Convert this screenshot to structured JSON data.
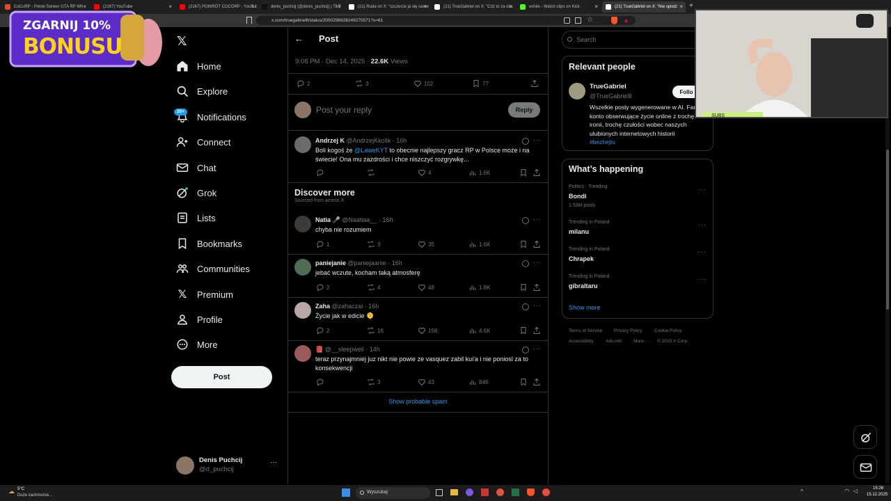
{
  "browser": {
    "tabs": [
      {
        "label": "CoCoRP - Polski Serwer GTA RP Wh",
        "color": "#e14b2a"
      },
      {
        "label": "(2167) YouTube",
        "color": "#ff0000"
      },
      {
        "label": "(2167) POWRÓT COCORP - YouTube",
        "color": "#ff0000"
      },
      {
        "label": "denis_puchcij (@denis_puchcij) | TikT",
        "color": "#111111"
      },
      {
        "label": "(21) Ruda on X: \"szczerze ja się same",
        "color": "#ffffff"
      },
      {
        "label": "(21) TrueGabriel on X: \"Cóż to za obs",
        "color": "#ffffff"
      },
      {
        "label": "eshiie - Watch clips on Kick",
        "color": "#53fc18"
      },
      {
        "label": "(21) TrueGabriel on X: \"Nie spodz",
        "color": "#ffffff"
      }
    ],
    "url": "x.com/truegabrielll/status/2000296928249270571?s=61"
  },
  "promo": {
    "line1": "ZGARNIJ 10%",
    "line2": "BONUSU"
  },
  "nav": {
    "items": [
      "Home",
      "Explore",
      "Notifications",
      "Connect",
      "Chat",
      "Grok",
      "Lists",
      "Bookmarks",
      "Communities",
      "Premium",
      "Profile",
      "More"
    ],
    "notif_badge": "20+",
    "post_button": "Post"
  },
  "account": {
    "name": "Denis Puchcij",
    "handle": "@d_puchcij"
  },
  "header": {
    "title": "Post"
  },
  "main_post": {
    "time": "9:08 PM · Dec 14, 2025 · ",
    "views_value": "22.6K",
    "views_label": " Views",
    "replies": "2",
    "reposts": "3",
    "likes": "102",
    "bookmarks": "77"
  },
  "reply_box": {
    "placeholder": "Post your reply",
    "button": "Reply"
  },
  "replies": [
    {
      "name": "Andrzej K",
      "handle": "@AndrzejKkolik · 16h",
      "text_before": "Boli kogoś że ",
      "mention": "@LaweKYT",
      "text_after": " to obecnie najlepszy gracz RP w Polsce może i na świecie! Ona mu zazdrości i chce niszczyć rozgrywkę...",
      "replies": "",
      "reposts": "",
      "likes": "4",
      "views": "1.6K"
    }
  ],
  "discover": {
    "title": "Discover more",
    "subtitle": "Sourced from across X"
  },
  "discover_posts": [
    {
      "name": "Natia",
      "emoji": "🎤",
      "handle": "@Naatiaa__ · 16h",
      "text": "chyba nie rozumiem",
      "replies": "1",
      "reposts": "3",
      "likes": "35",
      "views": "1.6K"
    },
    {
      "name": "paniejanie",
      "emoji": "",
      "handle": "@paniejaanie · 16h",
      "text": "jebać wczute, kocham taką atmosferę",
      "replies": "2",
      "reposts": "4",
      "likes": "48",
      "views": "1.8K"
    },
    {
      "name": "Zaha",
      "emoji": "",
      "handle": "@zahaczai · 16h",
      "text": "Życie jak w edicie 🫠",
      "replies": "2",
      "reposts": "16",
      "likes": "158",
      "views": "4.6K"
    },
    {
      "name": "",
      "emoji": "📕",
      "handle": "@__sleepwell · 14h",
      "text": "teraz przynajmniej juz nikt nie powie ze vasquez zabil kui'a i nie poniosl za to konsekwencji",
      "replies": "",
      "reposts": "3",
      "likes": "43",
      "views": "846"
    }
  ],
  "show_spam": "Show probable spam",
  "search": {
    "placeholder": "Search"
  },
  "relevant": {
    "title": "Relevant people",
    "name": "TrueGabriel",
    "handle": "@TrueGabrielll",
    "follow": "Follo",
    "bio": "Wszelkie posty wygenerowane w AI. Fan konto obserwujące życie online z trochę ironii, trochę czułości wobec naszych ulubionych internetowych historii ",
    "hashtag": "#bezhejtu"
  },
  "happening": {
    "title": "What’s happening",
    "trends": [
      {
        "category": "Politics · Trending",
        "name": "Bondi",
        "count": "1.58M posts"
      },
      {
        "category": "Trending in Poland",
        "name": "milanu",
        "count": ""
      },
      {
        "category": "Trending in Poland",
        "name": "Chrapek",
        "count": ""
      },
      {
        "category": "Trending in Poland",
        "name": "gibraltaru",
        "count": ""
      }
    ],
    "show_more": "Show more"
  },
  "footer": {
    "links": [
      "Terms of Service",
      "Privacy Policy",
      "Cookie Policy",
      "Accessibility",
      "Ads info",
      "More ···",
      "© 2025 X Corp."
    ]
  },
  "webcam": {
    "subs_label": "SUBS"
  },
  "taskbar": {
    "weather_temp": "5°C",
    "weather_desc": "Duże zachmurze...",
    "search": "Wyszukaj",
    "time": "15:26",
    "date": "15.12.2025"
  }
}
